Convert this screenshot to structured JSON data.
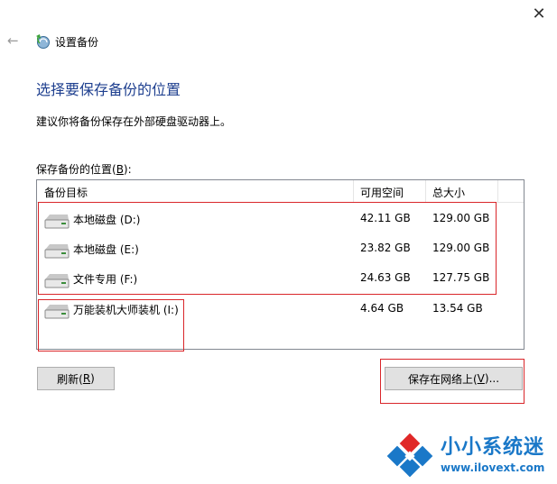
{
  "window": {
    "title": "设置备份",
    "close_glyph": "✕",
    "back_glyph": "←"
  },
  "heading": "选择要保存备份的位置",
  "description": "建议你将备份保存在外部硬盘驱动器上。",
  "location_label": {
    "text": "保存备份的位置(",
    "accel": "B",
    "suffix": "):"
  },
  "columns": {
    "target": "备份目标",
    "free_space": "可用空间",
    "total_size": "总大小"
  },
  "drives": [
    {
      "name": "本地磁盘 (D:)",
      "free": "42.11 GB",
      "total": "129.00 GB",
      "icon": "hard-drive-icon"
    },
    {
      "name": "本地磁盘 (E:)",
      "free": "23.82 GB",
      "total": "129.00 GB",
      "icon": "hard-drive-icon"
    },
    {
      "name": "文件专用 (F:)",
      "free": "24.63 GB",
      "total": "127.75 GB",
      "icon": "hard-drive-icon"
    },
    {
      "name": "万能装机大师装机 (I:)",
      "free": "4.64 GB",
      "total": "13.54 GB",
      "icon": "hard-drive-icon"
    }
  ],
  "buttons": {
    "refresh": {
      "text": "刷新(",
      "accel": "R",
      "suffix": ")"
    },
    "save_network": {
      "text": "保存在网络上(",
      "accel": "V",
      "suffix": ")..."
    }
  },
  "watermark": {
    "title": "小小系统迷",
    "url": "www.ilovext.com"
  },
  "colors": {
    "heading": "#1e3f8f",
    "highlight_box": "#d9262a",
    "watermark": "#1a78c8",
    "button_bg": "#e1e1e1"
  }
}
